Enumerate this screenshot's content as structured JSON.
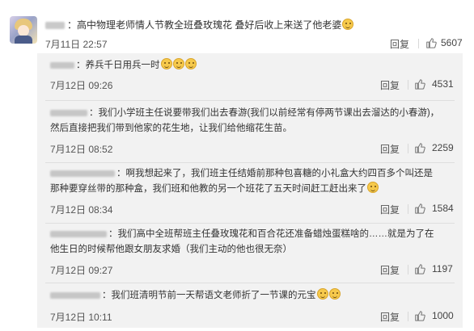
{
  "main_comment": {
    "text": "：高中物理老师情人节教全班叠玫瑰花 叠好后收上来送了他老婆",
    "time": "7月11日 22:57",
    "reply_label": "回复",
    "likes": "5607"
  },
  "replies": [
    {
      "text": "：养兵千日用兵一时",
      "time": "7月12日 09:26",
      "reply_label": "回复",
      "likes": "4531"
    },
    {
      "text_line1": "：我们小学班主任说要带我们出去春游(我们以前经常有停两节课出去溜达的小春游)，",
      "text_line2": "然后直接把我们带到他家的花生地，让我们给他缩花生苗。",
      "time": "7月12日 08:52",
      "reply_label": "回复",
      "likes": "2259"
    },
    {
      "text_line1": "：啊我想起来了，我们班主任结婚前那种包喜糖的小礼盒大约四百多个叫还是",
      "text_line2": "那种要穿丝带的那种盒，我们班和他教的另一个班花了五天时间赶工赶出来了",
      "time": "7月12日 08:34",
      "reply_label": "回复",
      "likes": "1584"
    },
    {
      "text_line1": "：我们高中全班帮班主任叠玫瑰花和百合花还准备蜡烛蛋糕啥的……就是为了在",
      "text_line2": "他生日的时候帮他跟女朋友求婚（我们主动的他也很无奈）",
      "time": "7月12日 09:27",
      "reply_label": "回复",
      "likes": "1197"
    },
    {
      "text": "：我们班清明节前一天帮语文老师折了一节课的元宝",
      "time": "7月12日 10:11",
      "reply_label": "回复",
      "likes": "1000"
    }
  ],
  "icons": {
    "like": "thumbs-up-icon",
    "emoji": "smiley-emoji-icon",
    "avatar": "anime-avatar"
  },
  "colors": {
    "reply_bg": "#f2f2f2",
    "text": "#333333",
    "meta": "#555555",
    "emoji": "#f6c94b"
  }
}
